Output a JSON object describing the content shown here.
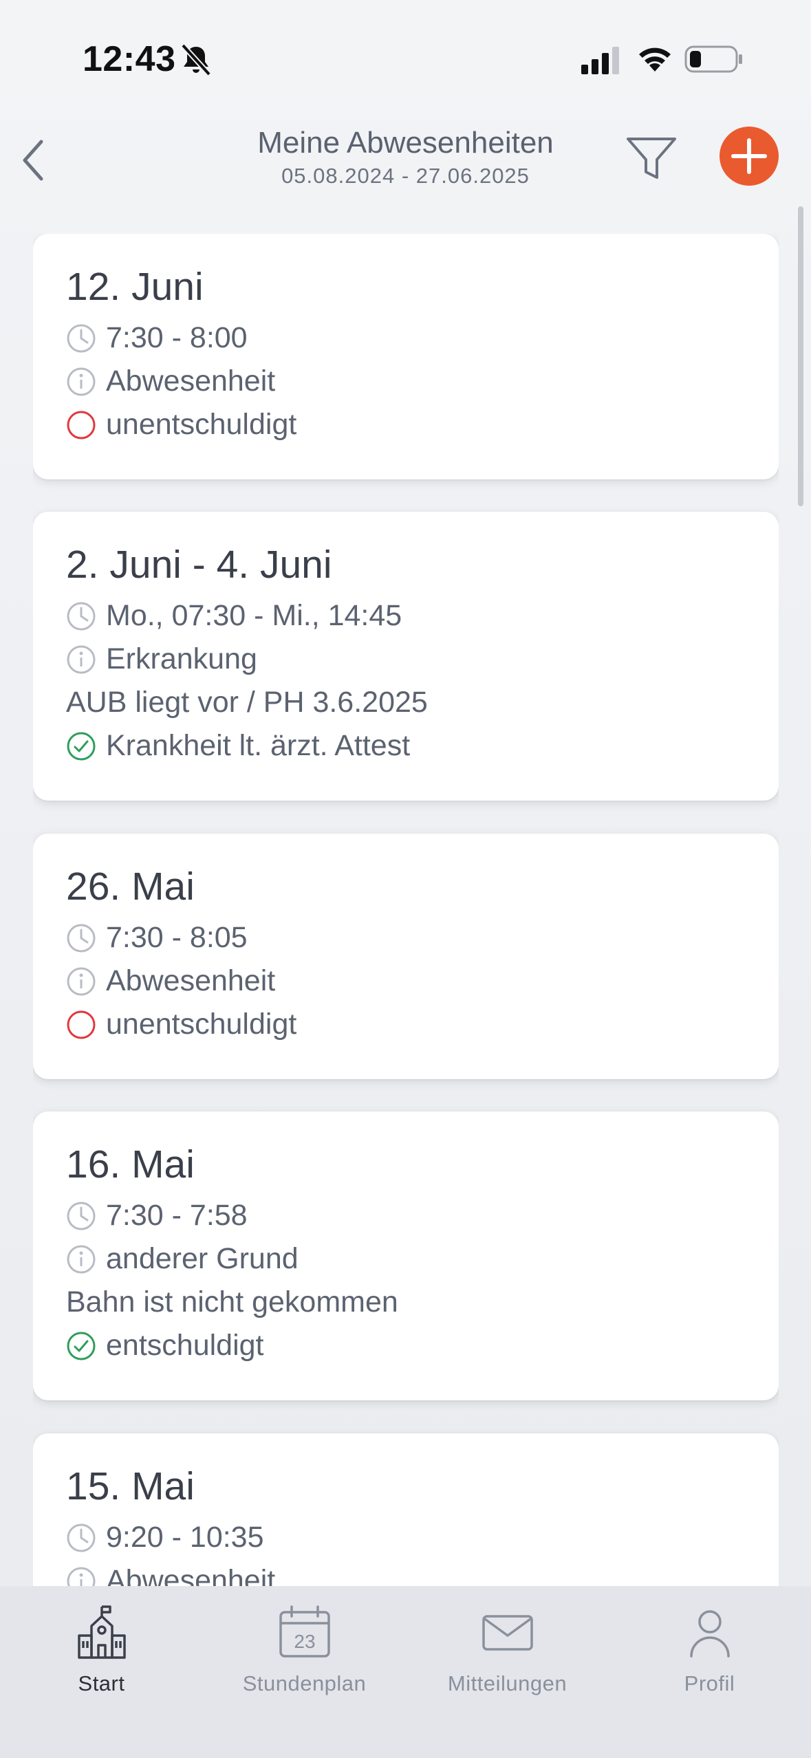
{
  "status_bar": {
    "time": "12:43"
  },
  "header": {
    "title": "Meine Abwesenheiten",
    "date_range": "05.08.2024 - 27.06.2025"
  },
  "absences": [
    {
      "date": "12. Juni",
      "time": "7:30 - 8:00",
      "reason": "Abwesenheit",
      "status": "unentschuldigt",
      "status_type": "unexcused"
    },
    {
      "date": "2. Juni - 4. Juni",
      "time": "Mo., 07:30 - Mi., 14:45",
      "reason": "Erkrankung",
      "note": "AUB liegt vor / PH 3.6.2025",
      "status": "Krankheit lt. ärzt. Attest",
      "status_type": "excused"
    },
    {
      "date": "26. Mai",
      "time": "7:30 - 8:05",
      "reason": "Abwesenheit",
      "status": "unentschuldigt",
      "status_type": "unexcused"
    },
    {
      "date": "16. Mai",
      "time": "7:30 - 7:58",
      "reason": "anderer Grund",
      "note": "Bahn ist nicht gekommen",
      "status": "entschuldigt",
      "status_type": "excused"
    },
    {
      "date": "15. Mai",
      "time": "9:20 - 10:35",
      "reason": "Abwesenheit"
    }
  ],
  "tabbar": {
    "tabs": [
      {
        "label": "Start",
        "icon": "school-icon",
        "active": true
      },
      {
        "label": "Stundenplan",
        "icon": "calendar-icon",
        "calendar_day": "23"
      },
      {
        "label": "Mitteilungen",
        "icon": "envelope-icon"
      },
      {
        "label": "Profil",
        "icon": "person-icon"
      }
    ]
  },
  "colors": {
    "accent": "#ea5a2f",
    "excused": "#2f9e5b",
    "unexcused": "#e0393e",
    "muted_icon": "#b8bcc4"
  }
}
